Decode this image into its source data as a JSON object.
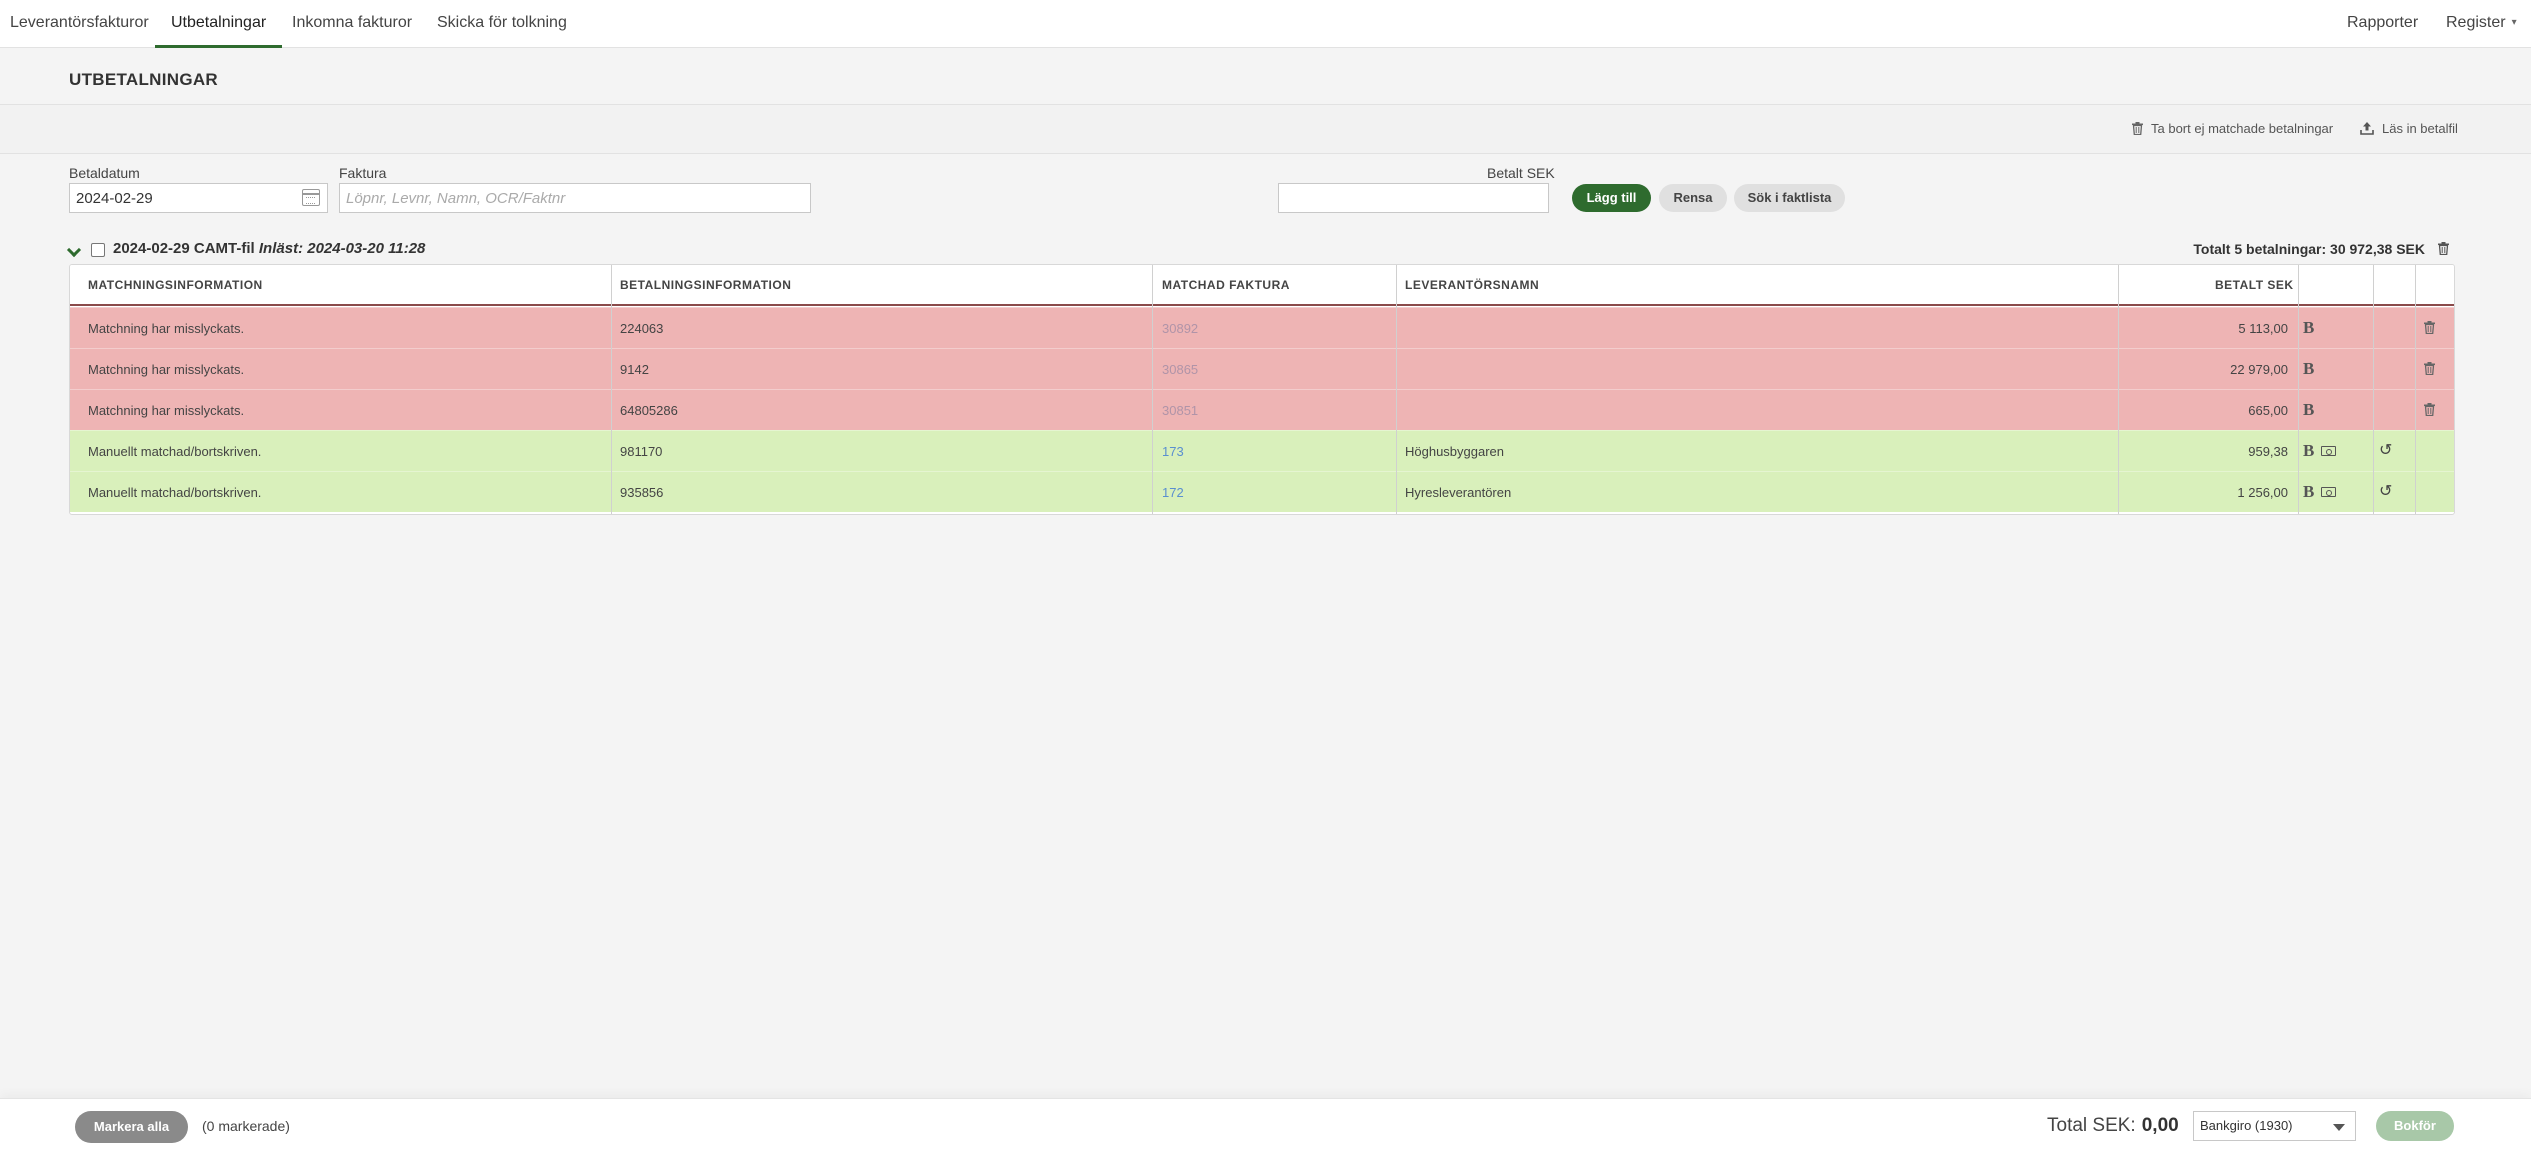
{
  "nav": {
    "tabs": [
      {
        "label": "Leverantörsfakturor"
      },
      {
        "label": "Utbetalningar"
      },
      {
        "label": "Inkomna fakturor"
      },
      {
        "label": "Skicka för tolkning"
      }
    ],
    "right": [
      {
        "label": "Rapporter"
      },
      {
        "label": "Register"
      }
    ]
  },
  "page": {
    "title": "UTBETALNINGAR",
    "actions": {
      "delete_unmatched": "Ta bort ej matchade betalningar",
      "import_file": "Läs in betalfil"
    }
  },
  "filters": {
    "date_label": "Betaldatum",
    "date_value": "2024-02-29",
    "invoice_label": "Faktura",
    "invoice_placeholder": "Löpnr, Levnr, Namn, OCR/Faktnr",
    "amount_label": "Betalt SEK",
    "amount_value": "",
    "add_button": "Lägg till",
    "clear_button": "Rensa",
    "search_button": "Sök i faktlista"
  },
  "group": {
    "title": "2024-02-29 CAMT-fil",
    "imported": "Inläst: 2024-03-20 11:28",
    "total": "Totalt 5 betalningar: 30 972,38 SEK"
  },
  "table": {
    "headers": {
      "matching": "MATCHNINGSINFORMATION",
      "payment": "BETALNINGSINFORMATION",
      "invoice": "MATCHAD FAKTURA",
      "supplier": "LEVERANTÖRSNAMN",
      "amount": "BETALT SEK"
    },
    "rows": [
      {
        "status": "failed",
        "matching": "Matchning har misslyckats.",
        "payment": "224063",
        "invoice": "30892",
        "supplier": "",
        "amount": "5 113,00"
      },
      {
        "status": "failed",
        "matching": "Matchning har misslyckats.",
        "payment": "9142",
        "invoice": "30865",
        "supplier": "",
        "amount": "22 979,00"
      },
      {
        "status": "failed",
        "matching": "Matchning har misslyckats.",
        "payment": "64805286",
        "invoice": "30851",
        "supplier": "",
        "amount": "665,00"
      },
      {
        "status": "matched",
        "matching": "Manuellt matchad/bortskriven.",
        "payment": "981170",
        "invoice": "173",
        "supplier": "Höghusbyggaren",
        "amount": "959,38"
      },
      {
        "status": "matched",
        "matching": "Manuellt matchad/bortskriven.",
        "payment": "935856",
        "invoice": "172",
        "supplier": "Hyresleverantören",
        "amount": "1 256,00"
      }
    ]
  },
  "footer": {
    "select_all": "Markera alla",
    "selected_count": "(0 markerade)",
    "total_label": "Total SEK:",
    "total_value": "0,00",
    "account": "Bankgiro (1930)",
    "book_button": "Bokför"
  },
  "colors": {
    "accent": "#2e6b2e",
    "failed_row": "#eeb4b4",
    "matched_row": "#d9f0bb",
    "link": "#5a8fd0"
  }
}
